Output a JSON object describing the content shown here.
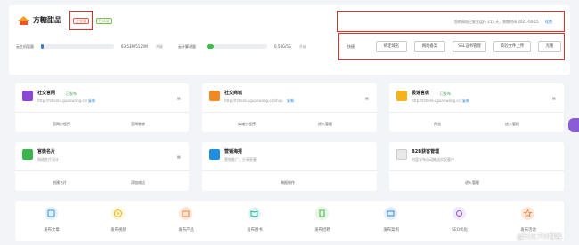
{
  "header": {
    "site_name": "方糖甜品",
    "badge_enterprise": "企业版",
    "badge_verified": "已认证",
    "notice": "您的网站已安全运行 215 天，到期时间 2021-04-15",
    "renew_label": "续费"
  },
  "usage": {
    "cloud_data_label": "云主机容量",
    "cloud_data_value": "63.53M/5120M",
    "cloud_data_action": "升级",
    "cloud_data_fraction": 0.0124,
    "traffic_label": "云计算流量",
    "traffic_value": "0.53G/5G",
    "traffic_action": "升级",
    "traffic_fraction": 0.106
  },
  "quick": {
    "label": "快捷",
    "buttons": [
      "绑定域名",
      "网站备案",
      "SSL证书管理",
      "校验文件上传",
      "克隆"
    ]
  },
  "products": [
    {
      "title": "社交官网",
      "status": "已发布",
      "url": "http://fzhenlu.guanwang.cc/",
      "copy": "复制",
      "actions": [
        "官网小程序",
        "官网装修"
      ],
      "color": "#8b46d6"
    },
    {
      "title": "社交商城",
      "status": "",
      "url": "http://fzhenlu.guanwang.cc/shop",
      "copy": "复制",
      "actions": [
        "商城小程序",
        "进入管理"
      ],
      "color": "#f08a24"
    },
    {
      "title": "极速官微",
      "status": "已发布",
      "url": "http://fzhenlu.guanwang.cc/",
      "copy": "复制",
      "actions": [
        "预览",
        "进入管理"
      ],
      "color": "#f6b21b"
    },
    {
      "title": "官微名片",
      "status": "",
      "url": "网络名片设计",
      "copy": "",
      "actions": [
        "创建名片",
        "添加成员"
      ],
      "color": "#3ab54a"
    },
    {
      "title": "营销海报",
      "status": "",
      "url": "营销推广，分享获客",
      "copy": "",
      "actions": [
        "海报制作"
      ],
      "color": "#1d8ee0"
    },
    {
      "title": "B2B获客管理",
      "status": "",
      "url": "内容发布自动推送实现客户",
      "copy": "",
      "actions": [
        "进入管理"
      ],
      "color": "#e8e8e8"
    }
  ],
  "quick_links": [
    {
      "label": "发布文章",
      "color": "#e3f1fc",
      "fg": "#3d8fe0",
      "icon": "edit-icon"
    },
    {
      "label": "发布视频",
      "color": "#fdf6d8",
      "fg": "#e9b31c",
      "icon": "play-icon"
    },
    {
      "label": "发布产品",
      "color": "#fde9dc",
      "fg": "#ef7b39",
      "icon": "shop-icon"
    },
    {
      "label": "发布图书",
      "color": "#e4f6f4",
      "fg": "#25b3a4",
      "icon": "book-icon"
    },
    {
      "label": "发布招聘",
      "color": "#e5f6e4",
      "fg": "#43b64b",
      "icon": "doc-icon"
    },
    {
      "label": "发布案例",
      "color": "#e3effc",
      "fg": "#2f87d8",
      "icon": "inbox-icon"
    },
    {
      "label": "SEO优化",
      "color": "#f0e8fc",
      "fg": "#8f59d8",
      "icon": "settings-icon"
    },
    {
      "label": "发布活动",
      "color": "#fde9dc",
      "fg": "#ef7b39",
      "icon": "star-icon"
    }
  ],
  "watermark": "@51CTO博客"
}
